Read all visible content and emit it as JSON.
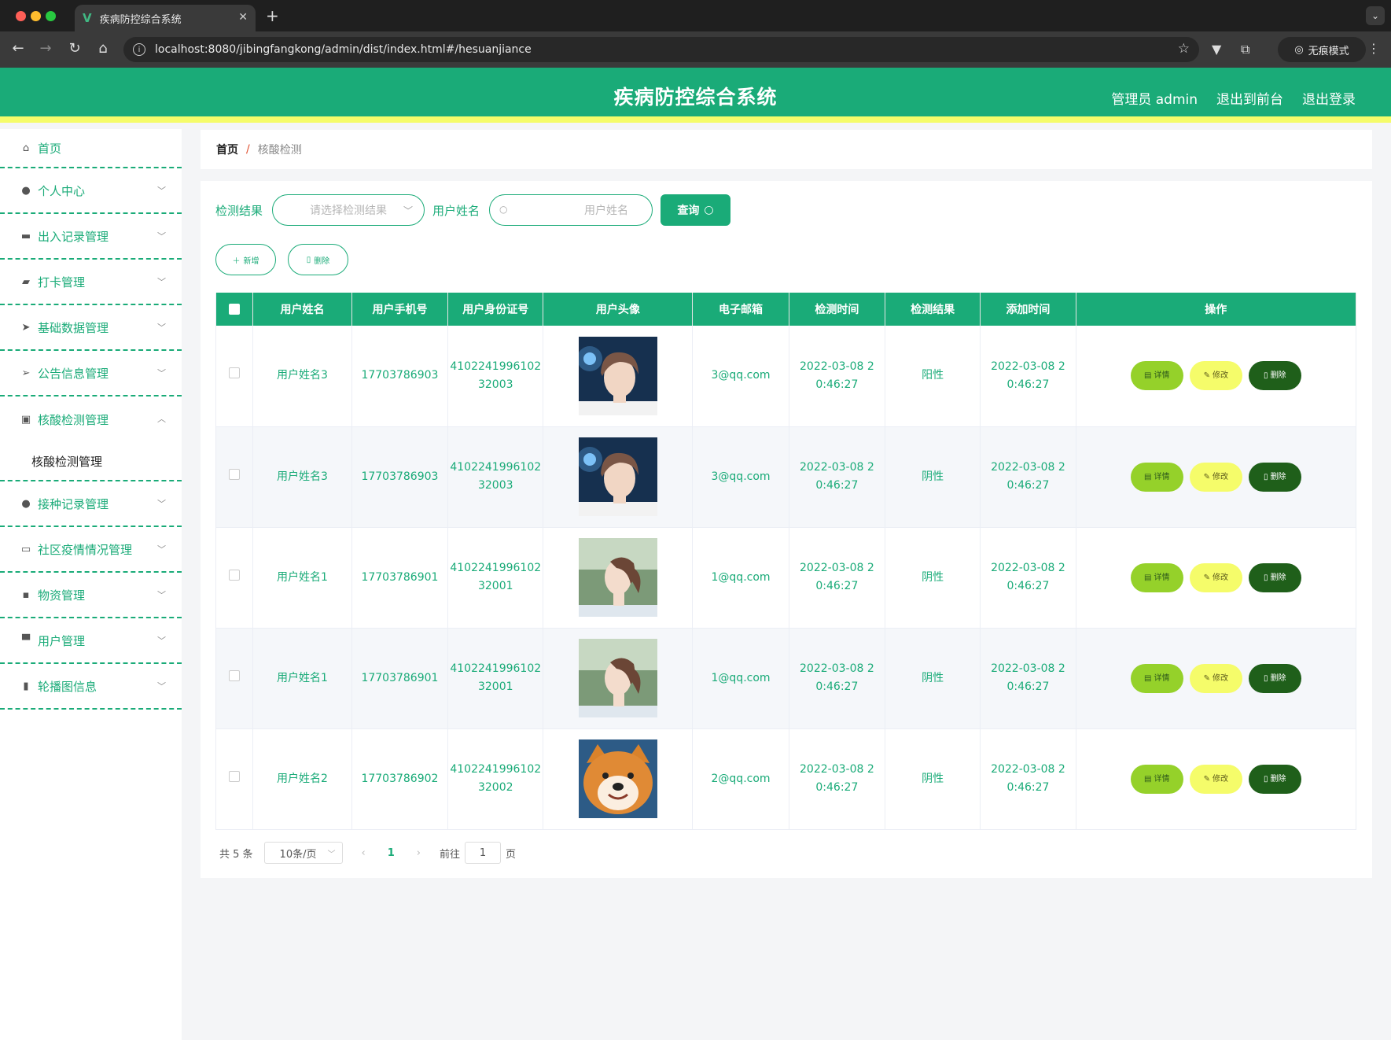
{
  "browser": {
    "tab_title": "疾病防控综合系统",
    "url": "localhost:8080/jibingfangkong/admin/dist/index.html#/hesuanjiance",
    "incognito_label": "无痕模式"
  },
  "header": {
    "title": "疾病防控综合系统",
    "admin_label": "管理员 admin",
    "to_front_label": "退出到前台",
    "logout_label": "退出登录"
  },
  "sidebar": {
    "items": [
      {
        "label": "首页",
        "icon": "home-icon"
      },
      {
        "label": "个人中心",
        "icon": "user-icon"
      },
      {
        "label": "出入记录管理",
        "icon": "printer-icon"
      },
      {
        "label": "打卡管理",
        "icon": "wallet-icon"
      },
      {
        "label": "基础数据管理",
        "icon": "send-icon"
      },
      {
        "label": "公告信息管理",
        "icon": "location-icon"
      },
      {
        "label": "核酸检测管理",
        "icon": "briefcase-icon"
      },
      {
        "label": "接种记录管理",
        "icon": "user-icon"
      },
      {
        "label": "社区疫情情况管理",
        "icon": "chat-icon"
      },
      {
        "label": "物资管理",
        "icon": "message-icon"
      },
      {
        "label": "用户管理",
        "icon": "postcard-icon"
      },
      {
        "label": "轮播图信息",
        "icon": "chart-icon"
      }
    ],
    "submenu_label": "核酸检测管理"
  },
  "breadcrumb": {
    "home": "首页",
    "separator": "/",
    "current": "核酸检测"
  },
  "search": {
    "result_label": "检测结果",
    "result_placeholder": "请选择检测结果",
    "name_label": "用户姓名",
    "name_placeholder": "用户姓名",
    "query_label": "查询"
  },
  "actions": {
    "add_label": "新增",
    "delete_label": "删除"
  },
  "table": {
    "headers": [
      "用户姓名",
      "用户手机号",
      "用户身份证号",
      "用户头像",
      "电子邮箱",
      "检测时间",
      "检测结果",
      "添加时间",
      "操作"
    ],
    "rows": [
      {
        "name": "用户姓名3",
        "phone": "17703786903",
        "id1": "4102241996102",
        "id2": "32003",
        "avatar": "boy",
        "email": "3@qq.com",
        "test1": "2022-03-08 2",
        "test2": "0:46:27",
        "result": "阳性",
        "add1": "2022-03-08 2",
        "add2": "0:46:27"
      },
      {
        "name": "用户姓名3",
        "phone": "17703786903",
        "id1": "4102241996102",
        "id2": "32003",
        "avatar": "boy",
        "email": "3@qq.com",
        "test1": "2022-03-08 2",
        "test2": "0:46:27",
        "result": "阴性",
        "add1": "2022-03-08 2",
        "add2": "0:46:27"
      },
      {
        "name": "用户姓名1",
        "phone": "17703786901",
        "id1": "4102241996102",
        "id2": "32001",
        "avatar": "girl",
        "email": "1@qq.com",
        "test1": "2022-03-08 2",
        "test2": "0:46:27",
        "result": "阴性",
        "add1": "2022-03-08 2",
        "add2": "0:46:27"
      },
      {
        "name": "用户姓名1",
        "phone": "17703786901",
        "id1": "4102241996102",
        "id2": "32001",
        "avatar": "girl",
        "email": "1@qq.com",
        "test1": "2022-03-08 2",
        "test2": "0:46:27",
        "result": "阴性",
        "add1": "2022-03-08 2",
        "add2": "0:46:27"
      },
      {
        "name": "用户姓名2",
        "phone": "17703786902",
        "id1": "4102241996102",
        "id2": "32002",
        "avatar": "dog",
        "email": "2@qq.com",
        "test1": "2022-03-08 2",
        "test2": "0:46:27",
        "result": "阴性",
        "add1": "2022-03-08 2",
        "add2": "0:46:27"
      }
    ],
    "ops": {
      "detail": "详情",
      "edit": "修改",
      "delete": "删除"
    }
  },
  "pagination": {
    "total_label": "共 5 条",
    "page_size": "10条/页",
    "current_page": "1",
    "goto_label": "前往",
    "goto_value": "1",
    "page_suffix": "页"
  },
  "colors": {
    "primary": "#1aab78",
    "accent_yellow": "#f5fc6a",
    "detail_green": "#95d12a",
    "delete_dark": "#1f5f1a"
  }
}
